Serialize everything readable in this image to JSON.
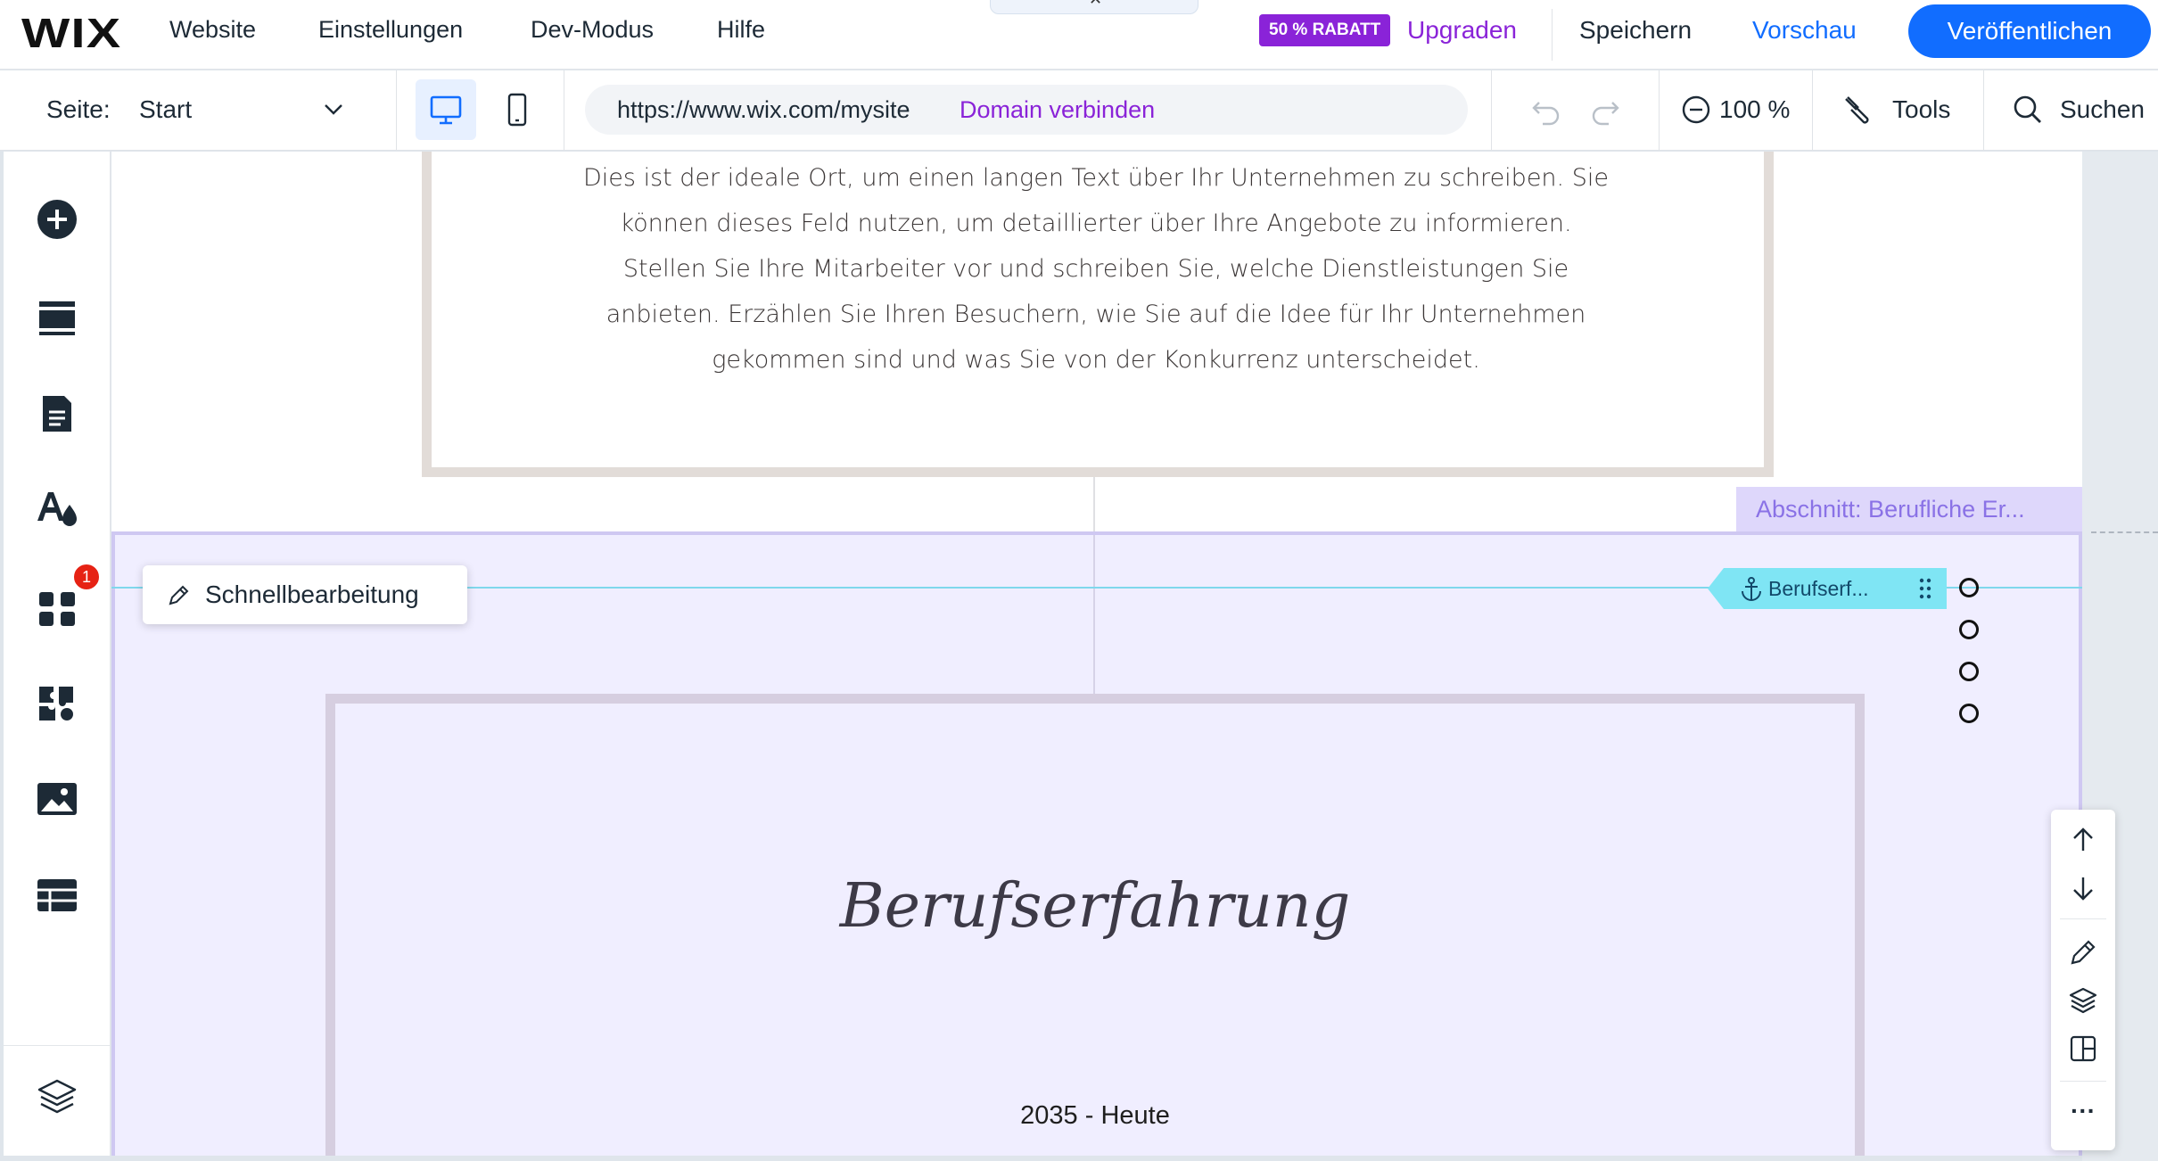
{
  "topbar": {
    "logo": "WIX",
    "menu": [
      "Website",
      "Einstellungen",
      "Dev-Modus",
      "Hilfe"
    ],
    "discount_badge": "50 % RABATT",
    "upgrade": "Upgraden",
    "save": "Speichern",
    "preview": "Vorschau",
    "publish": "Veröffentlichen"
  },
  "toolbar": {
    "page_label": "Seite:",
    "page_value": "Start",
    "url": "https://www.wix.com/mysite",
    "connect_domain": "Domain verbinden",
    "zoom": "100 %",
    "tools": "Tools",
    "search": "Suchen"
  },
  "sidebar": {
    "icons": [
      "add-elements-icon",
      "sections-icon",
      "pages-icon",
      "site-design-icon",
      "apps-icon",
      "business-apps-icon",
      "media-icon",
      "cms-icon",
      "layers-icon"
    ],
    "apps_notification": "1"
  },
  "canvas": {
    "about_text": "Dies ist der ideale Ort, um einen langen Text über Ihr Unternehmen zu schreiben. Sie können dieses Feld nutzen, um detaillierter über Ihre Angebote zu informieren. Stellen Sie Ihre Mitarbeiter vor und schreiben Sie, welche Dienstleistungen Sie anbieten. Erzählen Sie Ihren Besuchern, wie Sie auf die Idee für Ihr Unternehmen gekommen sind und was Sie von der Konkurrenz unterscheidet.",
    "section_label": "Abschnitt: Berufliche Er...",
    "quick_edit": "Schnellbearbeitung",
    "anchor_label": "Berufserf...",
    "heading": "Berufserfahrung",
    "period": "2035 - Heute"
  },
  "colors": {
    "accent": "#116dff",
    "purple": "#8a23d8",
    "section_bg": "#f0eeff",
    "anchor": "#7fe5f4"
  }
}
